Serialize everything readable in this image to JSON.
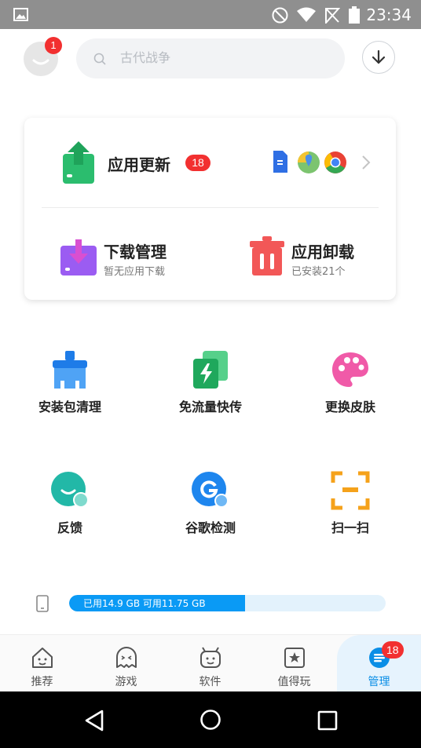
{
  "status_bar": {
    "time": "23:34",
    "icons": [
      "image-icon",
      "do-not-disturb-icon",
      "wifi-icon",
      "no-sim-icon",
      "battery-icon"
    ]
  },
  "header": {
    "avatar_badge": "1",
    "search_placeholder": "古代战争",
    "download_icon": "download-arrow-icon"
  },
  "card": {
    "update": {
      "title": "应用更新",
      "badge": "18"
    },
    "download_manager": {
      "title": "下载管理",
      "desc": "暂无应用下载"
    },
    "uninstall": {
      "title": "应用卸载",
      "desc": "已安装21个"
    }
  },
  "tools": [
    {
      "label": "安装包清理",
      "icon": "brush-cleanup-icon"
    },
    {
      "label": "免流量快传",
      "icon": "fast-transfer-icon"
    },
    {
      "label": "更换皮肤",
      "icon": "palette-icon"
    },
    {
      "label": "反馈",
      "icon": "feedback-chat-icon"
    },
    {
      "label": "谷歌检测",
      "icon": "google-check-icon"
    },
    {
      "label": "扫一扫",
      "icon": "scan-icon"
    }
  ],
  "storage": {
    "text": "已用14.9 GB 可用11.75 GB",
    "used_fraction": 0.555
  },
  "bottom_nav": [
    {
      "label": "推荐"
    },
    {
      "label": "游戏"
    },
    {
      "label": "软件"
    },
    {
      "label": "值得玩"
    },
    {
      "label": "管理",
      "badge": "18"
    }
  ],
  "colors": {
    "accent": "#0a9af5",
    "badge": "#f23030",
    "update_green": "#2bbd6e",
    "download_purple": "#9b5cf2",
    "uninstall_red": "#f25757"
  }
}
